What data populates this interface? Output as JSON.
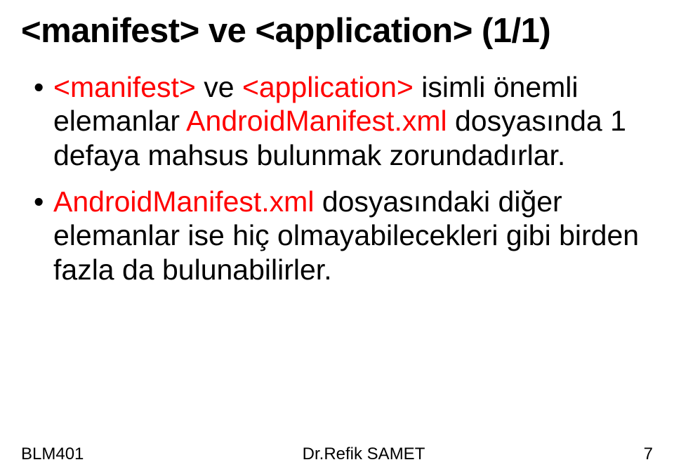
{
  "title": "<manifest> ve <application> (1/1)",
  "bullets": [
    {
      "parts": [
        {
          "text": "<manifest> ",
          "red": true
        },
        {
          "text": "ve ",
          "red": false
        },
        {
          "text": "<application> ",
          "red": true
        },
        {
          "text": "isimli önemli elemanlar ",
          "red": false
        },
        {
          "text": "AndroidManifest.xml ",
          "red": true
        },
        {
          "text": "dosyasında 1 defaya mahsus bulunmak zorundadırlar.",
          "red": false
        }
      ]
    },
    {
      "parts": [
        {
          "text": "AndroidManifest.xml ",
          "red": true
        },
        {
          "text": "dosyasındaki diğer elemanlar ise hiç olmayabilecekleri gibi birden fazla da bulunabilirler.",
          "red": false
        }
      ]
    }
  ],
  "footer": {
    "course": "BLM401",
    "author": "Dr.Refik SAMET",
    "page": "7"
  }
}
